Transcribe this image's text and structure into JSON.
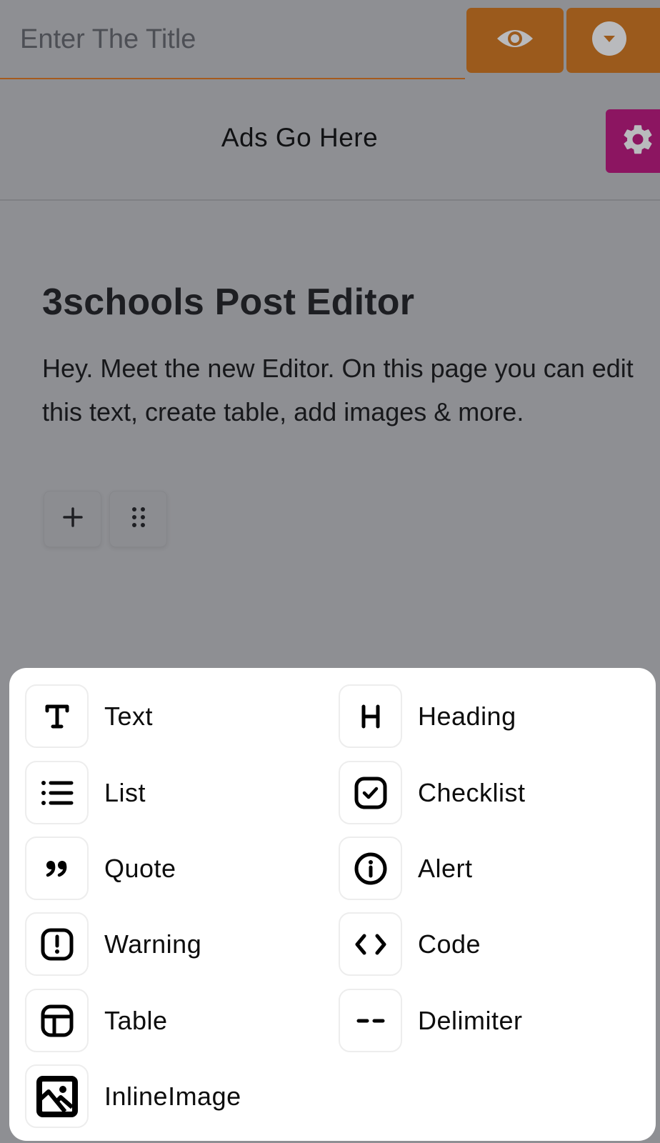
{
  "header": {
    "title_placeholder": "Enter The Title",
    "title_value": "",
    "preview_button_icon": "eye-icon",
    "dropdown_button_icon": "caret-circle-down-icon",
    "accent_color": "#9b5a1c"
  },
  "ads": {
    "text": "Ads Go Here",
    "settings_button_icon": "gear-icon",
    "settings_color": "#8c1561"
  },
  "editor": {
    "heading": "3schools Post Editor",
    "paragraph": "Hey. Meet the new Editor. On this page you can edit this text, create table, add images & more.",
    "toolbar": {
      "add_icon": "plus-icon",
      "drag_icon": "drag-handle-icon"
    }
  },
  "block_menu": {
    "items": [
      {
        "label": "Text",
        "icon": "text-icon"
      },
      {
        "label": "Heading",
        "icon": "heading-icon"
      },
      {
        "label": "List",
        "icon": "list-icon"
      },
      {
        "label": "Checklist",
        "icon": "checklist-icon"
      },
      {
        "label": "Quote",
        "icon": "quote-icon"
      },
      {
        "label": "Alert",
        "icon": "info-icon"
      },
      {
        "label": "Warning",
        "icon": "warning-icon"
      },
      {
        "label": "Code",
        "icon": "code-icon"
      },
      {
        "label": "Table",
        "icon": "table-icon"
      },
      {
        "label": "Delimiter",
        "icon": "delimiter-icon"
      },
      {
        "label": "InlineImage",
        "icon": "image-icon"
      }
    ]
  }
}
